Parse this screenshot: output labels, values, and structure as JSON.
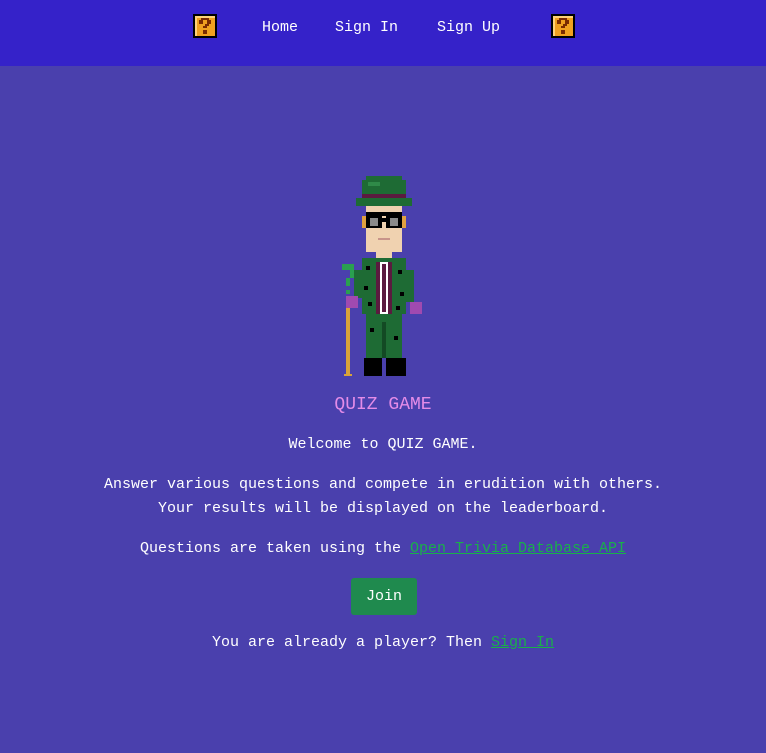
{
  "nav": {
    "left_icon": "question-block-icon",
    "right_icon": "question-block-icon",
    "links": [
      {
        "label": "Home"
      },
      {
        "label": "Sign In"
      },
      {
        "label": "Sign Up"
      }
    ]
  },
  "hero": {
    "image": "riddler-pixel-character",
    "title": "QUIZ GAME",
    "welcome": "Welcome to QUIZ GAME.",
    "description_line1": "Answer various questions and compete in erudition with others.",
    "description_line2": "Your results will be displayed on the leaderboard.",
    "api_prefix": "Questions are taken using the ",
    "api_link": "Open Trivia Database API",
    "join_label": "Join",
    "signin_prefix": "You are already a player? Then ",
    "signin_link": "Sign In"
  },
  "colors": {
    "background": "#4a40ad",
    "navbar": "#3522c9",
    "title": "#e48ce8",
    "link": "#19b04a",
    "button": "#1f8a4e"
  }
}
